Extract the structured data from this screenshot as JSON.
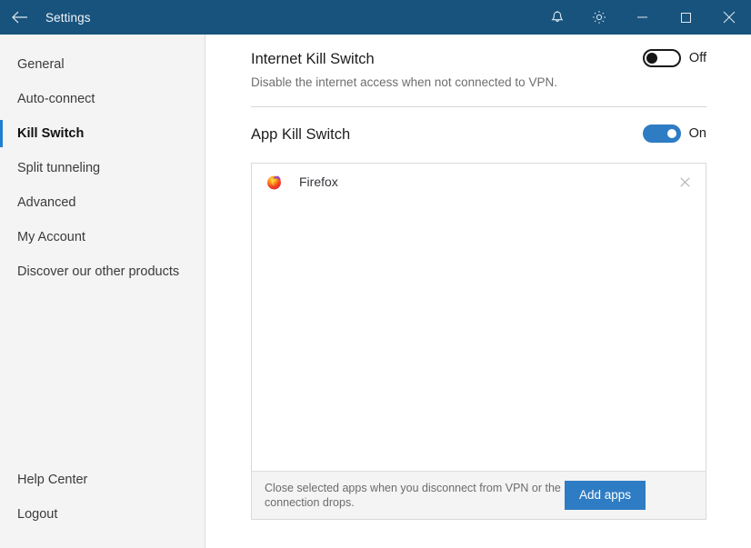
{
  "window": {
    "title": "Settings",
    "back_icon": "arrow-left-icon",
    "titlebar_color": "#18537d",
    "actions": [
      {
        "name": "notifications-button",
        "icon": "bell-icon"
      },
      {
        "name": "settings-button",
        "icon": "gear-icon"
      },
      {
        "name": "minimize-button",
        "icon": "minimize-icon"
      },
      {
        "name": "maximize-button",
        "icon": "maximize-icon"
      },
      {
        "name": "close-button",
        "icon": "close-icon"
      }
    ]
  },
  "sidebar": {
    "items": [
      {
        "label": "General",
        "active": false
      },
      {
        "label": "Auto-connect",
        "active": false
      },
      {
        "label": "Kill Switch",
        "active": true
      },
      {
        "label": "Split tunneling",
        "active": false
      },
      {
        "label": "Advanced",
        "active": false
      },
      {
        "label": "My Account",
        "active": false
      },
      {
        "label": "Discover our other products",
        "active": false
      }
    ],
    "bottom_items": [
      {
        "label": "Help Center"
      },
      {
        "label": "Logout"
      }
    ],
    "accent_color": "#1f7fd0"
  },
  "main": {
    "internet_kill_switch": {
      "title": "Internet Kill Switch",
      "description": "Disable the internet access when not connected to VPN.",
      "toggle_state": "Off",
      "toggle_on": false
    },
    "app_kill_switch": {
      "title": "App Kill Switch",
      "toggle_state": "On",
      "toggle_on": true,
      "apps": [
        {
          "name": "Firefox",
          "icon": "firefox-icon",
          "remove_icon": "close-icon"
        }
      ],
      "footer_text": "Close selected apps when you disconnect from VPN or the connection drops.",
      "add_button_label": "Add apps",
      "accent_color": "#2e7cc4"
    }
  }
}
